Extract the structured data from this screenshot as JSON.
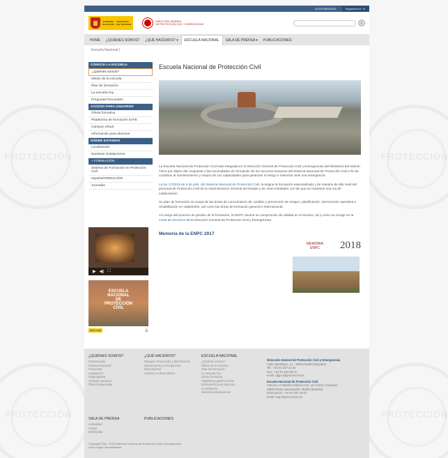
{
  "topbar": {
    "accessibility": "ACCESIBILIDAD",
    "follow": "Síguenos en"
  },
  "header": {
    "gob_line1": "GOBIERNO",
    "gob_line2": "DE ESPAÑA",
    "gob_ministry1": "MINISTERIO",
    "gob_ministry2": "DEL INTERIOR",
    "pc_line1": "DIRECCIÓN GENERAL",
    "pc_line2": "DE PROTECCIÓN CIVIL Y EMERGENCIAS"
  },
  "nav": [
    "HOME",
    "¿QUIÉNES SOMOS?",
    "¿QUÉ HACEMOS? ▾",
    "ESCUELA NACIONAL",
    "SALA DE PRENSA ▾",
    "PUBLICACIONES"
  ],
  "breadcrumb": "Escuela Nacional",
  "sidebar": {
    "sec1": "CONOCE LA ESCUELA",
    "sec1_items": [
      "¿Quiénes somos?",
      "Misión de la escuela",
      "Plan de formación",
      "La escuela hoy",
      "Preguntas frecuentes"
    ],
    "sec2": "ACCESO PARA USUARIOS",
    "sec2_items": [
      "Oferta formativa",
      "Plataforma de formación SAFE",
      "Campus virtual",
      "Información para alumnos"
    ],
    "sec3": "DÓNDE ESTAMOS",
    "sec3_items": [
      "Localización",
      "Nuestras instalaciones"
    ],
    "sec4": "+ FORMACIÓN",
    "sec4_items": [
      "Sistema de Formación en Protección Civil",
      "españaFORMACIÓN",
      "Jornadas"
    ]
  },
  "promo": {
    "line1": "ESCUELA",
    "line2": "NACIONAL",
    "line3": "DE",
    "line4": "PROTECCIÓN",
    "line5": "CIVIL",
    "badge": "ENPC 2018"
  },
  "main": {
    "title": "Escuela Nacional de Protección Civil",
    "p1": "La Escuela Nacional de Protección Civil está integrada en la Dirección General de Protección Civil y Emergencias del Ministerio del Interior. Tiene por objeto dar respuesta a las necesidades de formación de los recursos humanos del Sistema Nacional de Protección Civil a fin de contribuir al mantenimiento y mejora de sus capacidades para gestionar el riesgo e intervenir ante una emergencia.",
    "p2_link": "La ley 17/2015 de 9 de julio, del Sistema Nacional de Protección Civil,",
    "p2_rest": " le asigna la formación especializada y de mandos de alto nivel del personal de Protección Civil de la Administración General del Estado y de otras entidades con las que se mantiene una vía de colaboración.",
    "p3": "Su plan de formación se ocupa de las áreas de conocimiento de: análisis y prevención de riesgos, planificación, intervención operativa y rehabilitación en catástrofes, así como las áreas de formación general e internacional.",
    "p4_a": "A lo largo del proceso de gestión de la formación, la ENPC asume un compromiso de calidad en el servicio, tal y como se recoge en la ",
    "p4_link": "Carta de Servicios",
    "p4_b": " de la Dirección General de Protección Civil y Emergencias.",
    "memoria_heading": "Memoria de la ENPC 2017",
    "memoria_word": "MEMORIA",
    "memoria_sub": "ENPC",
    "memoria_year": "2018"
  },
  "footer": {
    "col1_title": "¿QUIÉNES SOMOS?",
    "col1": [
      "Presentación",
      "Sistema Nacional",
      "Funciones",
      "Legislación",
      "Organigrama",
      "Consejo Nacional",
      "Planes Especiales"
    ],
    "col2_title": "¿QUÉ HACEMOS?",
    "col2": [
      "Riesgos: Prevención y planificación",
      "Operaciones y emergencias",
      "Internacional",
      "Ayudas y subvenciones"
    ],
    "col3_title": "ESCUELA NACIONAL",
    "col3": [
      "¿Quiénes somos?",
      "Misión de la escuela",
      "Plan de formación",
      "La escuela hoy",
      "Oferta formativa",
      "Plataforma gestión SAFE",
      "Información para alumnos",
      "Localización",
      "Nuestras instalaciones"
    ],
    "col4_title": "SALA DE PRENSA",
    "col4": [
      "Actualidad",
      "Avisos",
      "Multimedia"
    ],
    "col5_title": "PUBLICACIONES",
    "contact1_title": "Dirección General de Protección Civil y Emergencias",
    "contact1": [
      "Calle Quintiliano, 21 - 28002 Madrid (España)",
      "Tel.: +34 91 537 31 00",
      "Fax.: +34 91 562 89 41",
      "email: dgpce@procivil.mir.es"
    ],
    "contact2_title": "Escuela Nacional de Protección Civil",
    "contact2": [
      "Autovía A-3 Madrid-Valencia Km. 19 Camino Zarzalejo -",
      "28500 Rivas Vaciamadrid, Madrid (España)",
      "Información: +34 91 537 34 00",
      "email: enpc@procivil.mir.es"
    ],
    "copyright": "Copyright 2011, 2020 Dirección General de Protección Civil y Emergencias",
    "legal": "Aviso Legal | Accesibilidad"
  }
}
